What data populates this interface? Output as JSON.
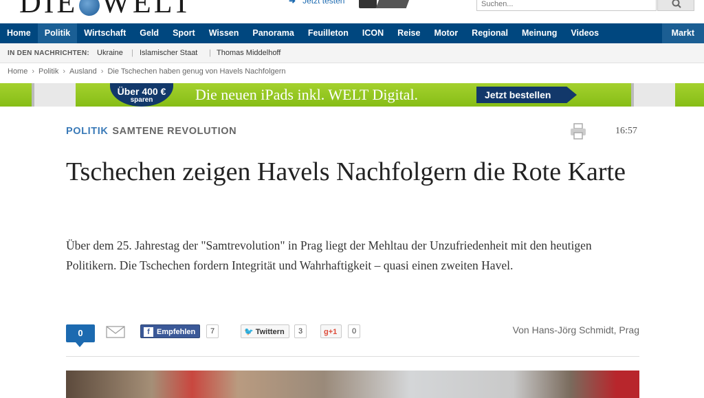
{
  "header": {
    "logo_text": "DIE WELT",
    "promo_text": "Jetzt testen",
    "search_placeholder": "Suchen..."
  },
  "nav": {
    "items": [
      "Home",
      "Politik",
      "Wirtschaft",
      "Geld",
      "Sport",
      "Wissen",
      "Panorama",
      "Feuilleton",
      "ICON",
      "Reise",
      "Motor",
      "Regional",
      "Meinung",
      "Videos",
      "Markt"
    ],
    "active": "Politik",
    "bg_color": "#00477f"
  },
  "ticker": {
    "label": "IN DEN NACHRICHTEN:",
    "items": [
      "Ukraine",
      "Islamischer Staat",
      "Thomas Middelhoff"
    ]
  },
  "breadcrumb": {
    "items": [
      "Home",
      "Politik",
      "Ausland",
      "Die Tschechen haben genug von Havels Nachfolgern"
    ]
  },
  "banner": {
    "badge_line1": "Über 400 €",
    "badge_line2": "sparen",
    "headline": "Die neuen iPads inkl. WELT Digital.",
    "cta": "Jetzt bestellen",
    "color": "#8cc21b"
  },
  "article": {
    "section": "POLITIK",
    "topic": "SAMTENE REVOLUTION",
    "time": "16:57",
    "title": "Tschechen zeigen Havels Nachfolgern die Rote Karte",
    "lead": "Über dem 25. Jahrestag der \"Samtrevolution\" in Prag liegt der Mehltau der Unzufriedenheit mit den heutigen Politikern. Die Tschechen fordern Integrität und Wahrhaftigkeit – quasi einen zweiten Havel.",
    "author": "Von Hans-Jörg Schmidt, Prag"
  },
  "social": {
    "comments": "0",
    "facebook_label": "Empfehlen",
    "facebook_count": "7",
    "twitter_label": "Twittern",
    "twitter_count": "3",
    "gplus_label": "+1",
    "gplus_count": "0"
  }
}
